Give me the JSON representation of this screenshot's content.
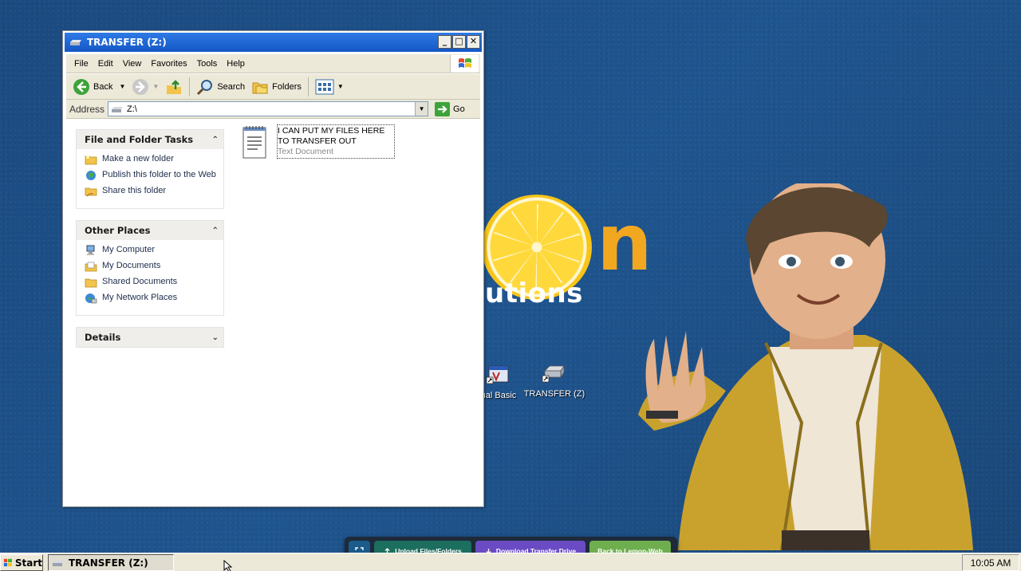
{
  "desktop": {
    "logo_sub": "utions",
    "logo_letter": "n",
    "icons": [
      {
        "label": "ual Basic",
        "icon": "vb-shortcut-icon"
      },
      {
        "label": "TRANSFER (Z)",
        "icon": "drive-shortcut-icon"
      }
    ]
  },
  "window": {
    "title": "TRANSFER (Z:)",
    "controls": {
      "minimize": "_",
      "maximize": "□",
      "close": "✕"
    },
    "menu": [
      "File",
      "Edit",
      "View",
      "Favorites",
      "Tools",
      "Help"
    ],
    "toolbar": {
      "back": "Back",
      "search": "Search",
      "folders": "Folders"
    },
    "address": {
      "label": "Address",
      "value": "Z:\\",
      "go": "Go"
    },
    "panels": {
      "file_tasks": {
        "title": "File and Folder Tasks",
        "items": [
          "Make a new folder",
          "Publish this folder to the Web",
          "Share this folder"
        ]
      },
      "other_places": {
        "title": "Other Places",
        "items": [
          "My Computer",
          "My Documents",
          "Shared Documents",
          "My Network Places"
        ]
      },
      "details": {
        "title": "Details"
      }
    },
    "file": {
      "name": "I CAN PUT MY FILES HERE TO TRANSFER OUT",
      "type": "Text Document"
    }
  },
  "taskbar": {
    "start": "Start",
    "task": "TRANSFER (Z:)",
    "clock": "10:05 AM"
  },
  "actionbar": {
    "upload": "Upload Files/Folders",
    "download": "Download Transfer Drive",
    "back": "Back to Lemon-Web"
  },
  "colors": {
    "desktop": "#1d4f86",
    "titlebar": "#1457c5",
    "upload": "#1c6e5f",
    "download": "#6a4bc4",
    "back": "#6fae4e"
  }
}
